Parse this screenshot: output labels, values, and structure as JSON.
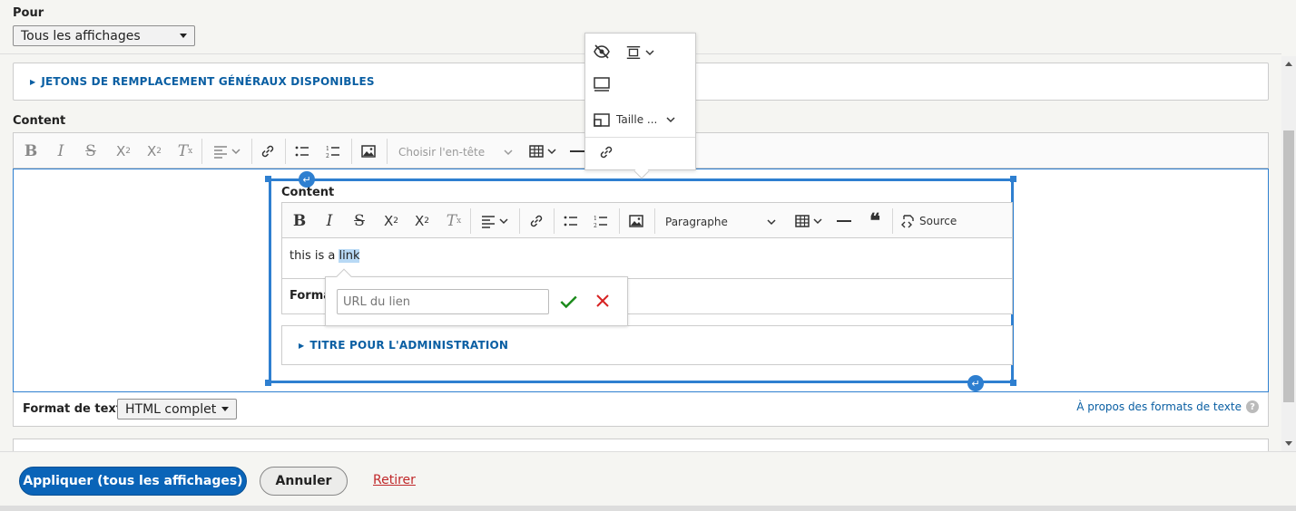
{
  "for_field": {
    "label": "Pour",
    "value": "Tous les affichages"
  },
  "tokens_details": {
    "label": "JETONS DE REMPLACEMENT GÉNÉRAUX DISPONIBLES"
  },
  "content_field": {
    "label": "Content"
  },
  "outer_toolbar": {
    "heading_select": "Choisir l'en-tête"
  },
  "image_toolbar": {
    "size_label": "Taille ..."
  },
  "inner_editor": {
    "label": "Content",
    "heading_select": "Paragraphe",
    "source_label": "Source",
    "text_before": "this is a ",
    "text_link": "link",
    "format_label_partial": "Forma",
    "admin_title_details": "TITRE POUR L'ADMINISTRATION"
  },
  "link_balloon": {
    "placeholder": "URL du lien"
  },
  "text_format": {
    "label": "Format de texte",
    "value": "HTML complet",
    "about_link": "À propos des formats de texte"
  },
  "actions": {
    "apply": "Appliquer (tous les affichages)",
    "cancel": "Annuler",
    "remove": "Retirer"
  },
  "colors": {
    "accent": "#0a64b8",
    "selection_blue": "#2e7fd0",
    "link_red": "#d72222",
    "confirm_green": "#1a8a1a"
  }
}
